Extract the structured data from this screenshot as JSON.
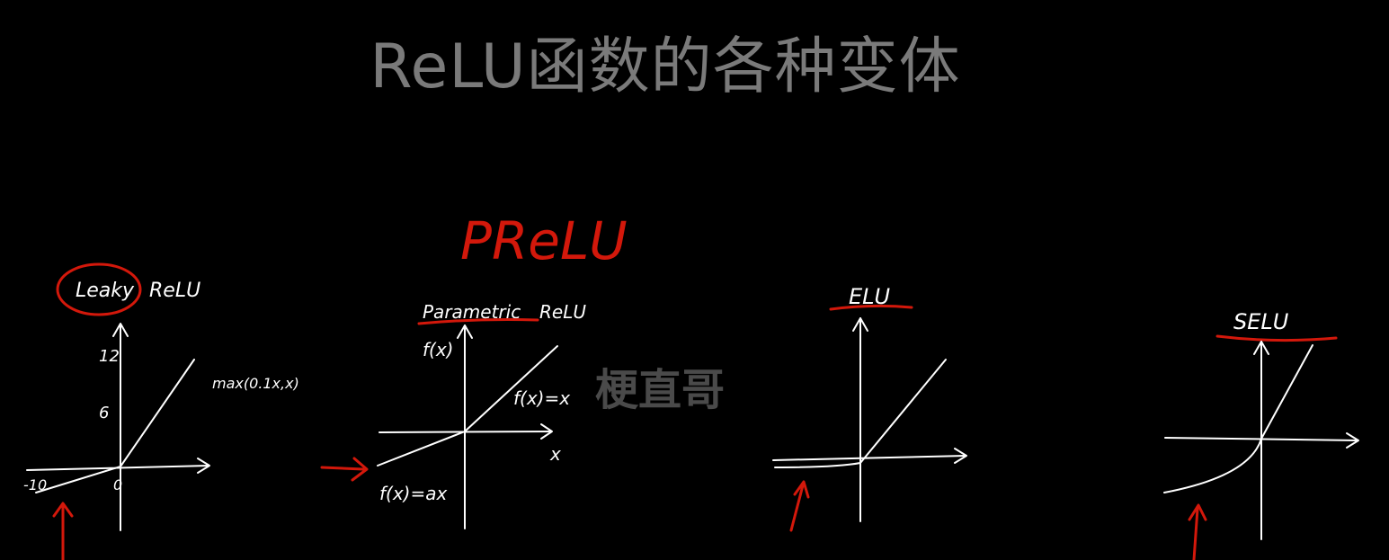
{
  "title": "ReLU函数的各种变体",
  "watermark": "梗直哥",
  "colors": {
    "background": "#000000",
    "title": "#7a7a7a",
    "chalk": "#ffffff",
    "highlight": "#d3180b",
    "watermark": "#4a4a4a"
  },
  "panels": {
    "leaky": {
      "label_a": "Leaky",
      "label_b": "ReLU",
      "formula": "max(0.1x,x)",
      "tick_12": "12",
      "tick_6": "6",
      "tick_neg10": "-10",
      "tick_0": "0"
    },
    "prelu": {
      "heading": "PReLU",
      "label_a": "Parametric",
      "label_b": "ReLU",
      "y_axis": "f(x)",
      "x_axis": "x",
      "formula_pos": "f(x)=x",
      "formula_neg": "f(x)=ax"
    },
    "elu": {
      "label": "ELU"
    },
    "selu": {
      "label": "SELU"
    }
  }
}
